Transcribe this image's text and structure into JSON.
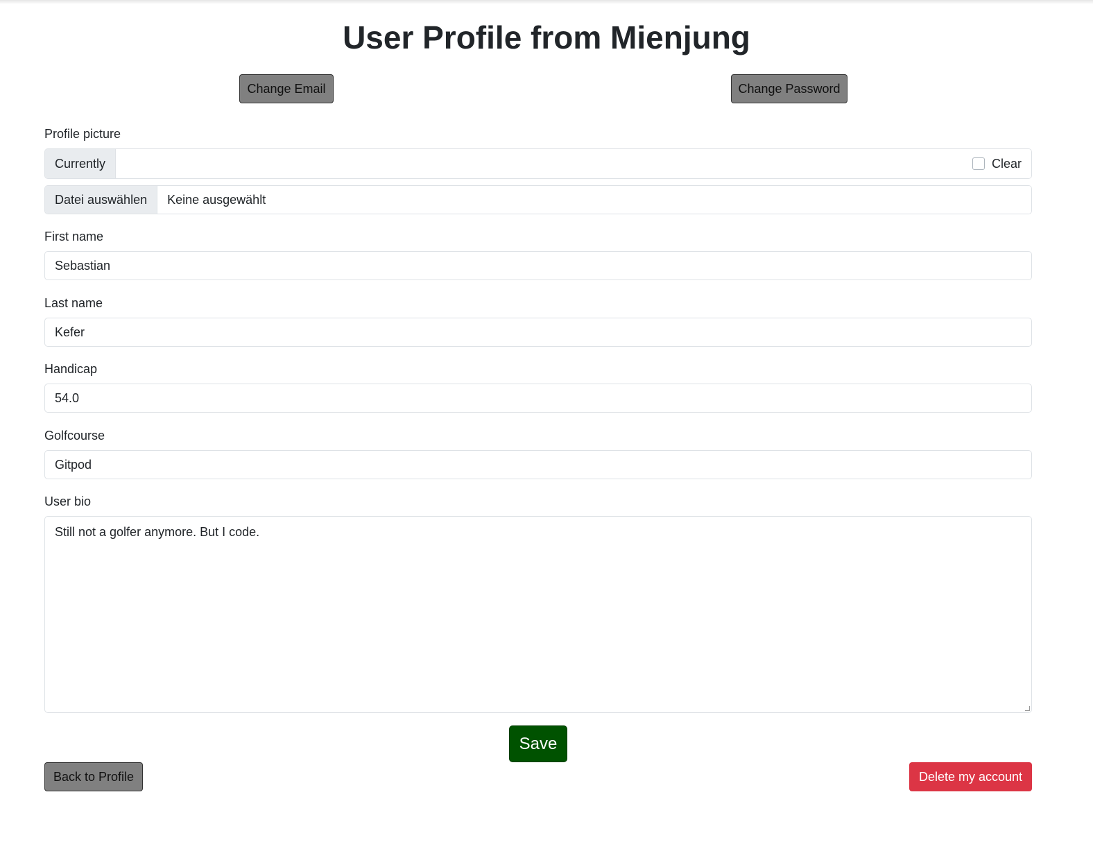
{
  "page": {
    "title": "User Profile from Mienjung"
  },
  "actions": {
    "change_email": "Change Email",
    "change_password": "Change Password"
  },
  "form": {
    "profile_picture": {
      "label": "Profile picture",
      "currently_label": "Currently",
      "clear_label": "Clear",
      "clear_checked": false,
      "file_button": "Datei auswählen",
      "file_status": "Keine ausgewählt"
    },
    "first_name": {
      "label": "First name",
      "value": "Sebastian"
    },
    "last_name": {
      "label": "Last name",
      "value": "Kefer"
    },
    "handicap": {
      "label": "Handicap",
      "value": "54.0"
    },
    "golfcourse": {
      "label": "Golfcourse",
      "value": "Gitpod"
    },
    "user_bio": {
      "label": "User bio",
      "value": "Still not a golfer anymore. But I code."
    },
    "save_label": "Save"
  },
  "footer": {
    "back_label": "Back to Profile",
    "delete_label": "Delete my account"
  },
  "colors": {
    "secondary_button": "#808080",
    "save_button": "#005200",
    "danger_button": "#dc3545",
    "input_border": "#dee2e6",
    "addon_background": "#e9ecef"
  }
}
